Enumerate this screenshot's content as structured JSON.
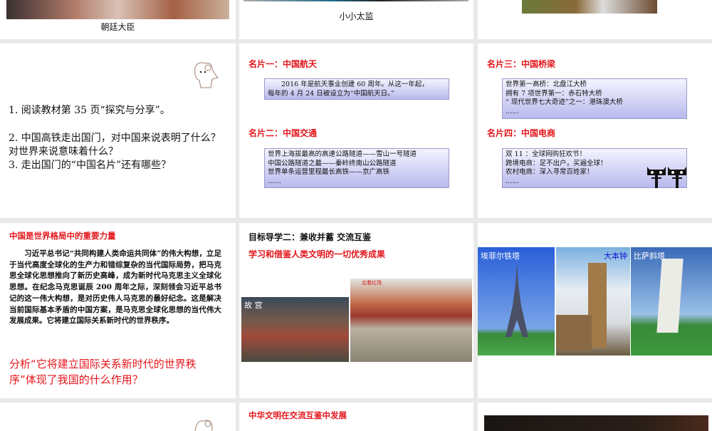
{
  "row1": {
    "slide1_caption": "朝廷大臣",
    "slide2_caption": "小小太监"
  },
  "slide_questions": {
    "q1": "1. 阅读教材第 35 页“探究与分享”。",
    "q2": "2.  中国高铁走出国门，对中国来说表明了什么？对世界来说意味着什么？",
    "q3": "3. 走出国门的“中国名片”还有哪些？"
  },
  "slide_cards_a": {
    "card1_title": "名片一：中国航天",
    "card1_lines": [
      "　　2016 年是航天事业创建 60 周年。从这一年起，",
      "每年的 4 月 24 日被设立为“中国航天日。”"
    ],
    "card2_title": "名片二：中国交通",
    "card2_lines": [
      "世界上海拔最高的高速公路隧道——雪山一号隧道",
      "中国公路隧道之最——秦岭终南山公路隧道",
      "世界单条运营里程最长高铁——京广高铁",
      "……"
    ]
  },
  "slide_cards_b": {
    "card3_title": "名片三：中国桥梁",
    "card3_lines": [
      "世界第一高桥：北盘江大桥",
      "拥有 7 项世界第一：赤石特大桥",
      "“ 现代世界七大奇迹”之一：港珠澳大桥",
      "……"
    ],
    "card4_title": "名片四：中国电商",
    "card4_lines": [
      "双 11 ：全球网购狂欢节！",
      "跨境电商：足不出户，买遍全球！",
      "农村电商：深入寻常百姓家！",
      "……"
    ]
  },
  "slide_power": {
    "title": "中国是世界格局中的重要力量",
    "body": "　　习近平总书记“共同构建人类命运共同体”的伟大构想，立足于当代高度全球化的生产力和错综复杂的当代国际局势，把马克思全球化思想推向了新历史高峰，成为新时代马克思主义全球化思想。在纪念马克思诞辰 200 周年之际，深刻领会习近平总书记的这一伟大构想，是对历史伟人马克思的最好纪念。这是解决当前国际基本矛盾的中国方案，是马克思全球化思想的当代伟大发展成果。它将建立国际关系新时代的世界秩序。",
    "question": "分析“它将建立国际关系新时代的世界秩序”体现了我国的什么作用？"
  },
  "slide_learn": {
    "title": "目标导学二：兼收并蓄 交流互鉴",
    "subtitle": "学习和借鉴人类文明的一切优秀成果",
    "photo1_label": "故 宫",
    "photo2_label": "北看红场"
  },
  "slide_landmarks": {
    "photo1_label": "埃菲尔铁塔",
    "photo2_label": "大本钟",
    "photo3_label": "比萨斜塔"
  },
  "row4": {
    "slide2_title": "中华文明在交流互鉴中发展"
  }
}
